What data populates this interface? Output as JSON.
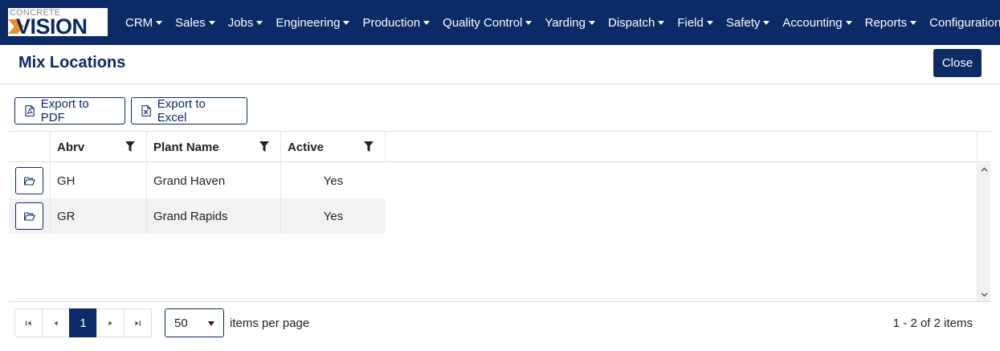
{
  "logo": {
    "top": "CONCRETE",
    "bottom": "VISION"
  },
  "nav": {
    "items": [
      {
        "label": "CRM"
      },
      {
        "label": "Sales"
      },
      {
        "label": "Jobs"
      },
      {
        "label": "Engineering"
      },
      {
        "label": "Production"
      },
      {
        "label": "Quality Control"
      },
      {
        "label": "Yarding"
      },
      {
        "label": "Dispatch"
      },
      {
        "label": "Field"
      },
      {
        "label": "Safety"
      },
      {
        "label": "Accounting"
      },
      {
        "label": "Reports"
      },
      {
        "label": "Configuration"
      }
    ]
  },
  "page": {
    "title": "Mix Locations",
    "close_label": "Close"
  },
  "toolbar": {
    "export_pdf": "Export to PDF",
    "export_excel": "Export to Excel"
  },
  "grid": {
    "columns": [
      {
        "label": "Abrv"
      },
      {
        "label": "Plant Name"
      },
      {
        "label": "Active"
      }
    ],
    "rows": [
      {
        "abrv": "GH",
        "plant_name": "Grand Haven",
        "active": "Yes"
      },
      {
        "abrv": "GR",
        "plant_name": "Grand Rapids",
        "active": "Yes"
      }
    ]
  },
  "pager": {
    "current_page": "1",
    "page_size": "50",
    "items_per_page_label": "items per page",
    "info": "1 - 2 of 2 items"
  },
  "colors": {
    "brand": "#0b2a66",
    "accent": "#f28c28",
    "row_alt": "#f2f2f2"
  }
}
